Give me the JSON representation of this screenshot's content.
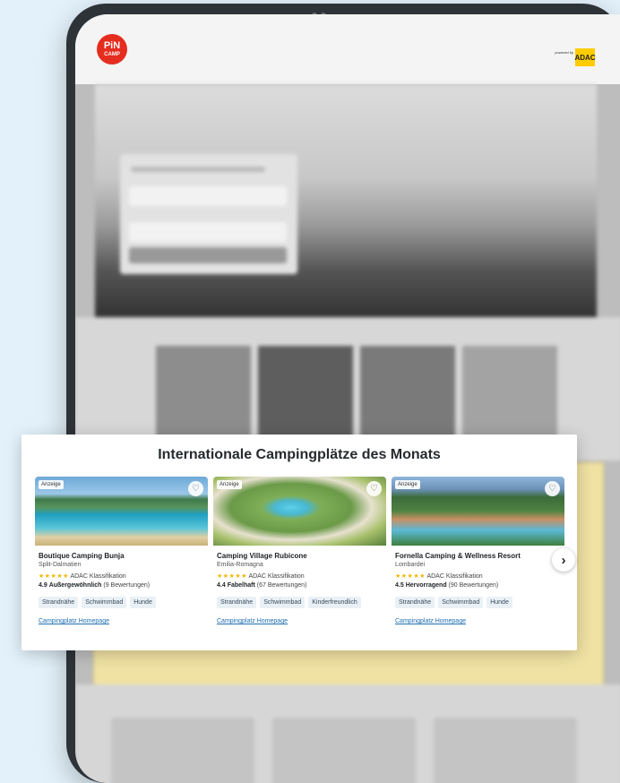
{
  "logo": {
    "line1": "PiN",
    "line2": "CAMP"
  },
  "partner": {
    "small_text": "powered by",
    "badge": "ADAC"
  },
  "section": {
    "title": "Internationale Campingplätze des Monats"
  },
  "cards": [
    {
      "badge": "Anzeige",
      "name": "Boutique Camping Bunja",
      "region": "Split-Dalmatien",
      "stars": "★★★★★",
      "classification": "ADAC Klassifikation",
      "score": "4.9",
      "score_label": "Außergewöhnlich",
      "reviews": "(9 Bewertungen)",
      "tags": [
        "Strandnähe",
        "Schwimmbad",
        "Hunde"
      ],
      "link": "Campingplatz Homepage"
    },
    {
      "badge": "Anzeige",
      "name": "Camping Village Rubicone",
      "region": "Emilia-Romagna",
      "stars": "★★★★★",
      "classification": "ADAC Klassifikation",
      "score": "4.4",
      "score_label": "Fabelhaft",
      "reviews": "(67 Bewertungen)",
      "tags": [
        "Strandnähe",
        "Schwimmbad",
        "Kinderfreundlich"
      ],
      "link": "Campingplatz Homepage"
    },
    {
      "badge": "Anzeige",
      "name": "Fornella Camping & Wellness Resort",
      "region": "Lombardei",
      "stars": "★★★★★",
      "classification": "ADAC Klassifikation",
      "score": "4.5",
      "score_label": "Hervorragend",
      "reviews": "(90 Bewertungen)",
      "tags": [
        "Strandnähe",
        "Schwimmbad",
        "Hunde"
      ],
      "link": "Campingplatz Homepage"
    }
  ],
  "icons": {
    "favorite": "heart-icon",
    "next": "chevron-right-icon"
  },
  "colors": {
    "brand": "#e52d1f",
    "adac": "#ffcc00",
    "link": "#1f6fb2",
    "star": "#f2b705"
  }
}
